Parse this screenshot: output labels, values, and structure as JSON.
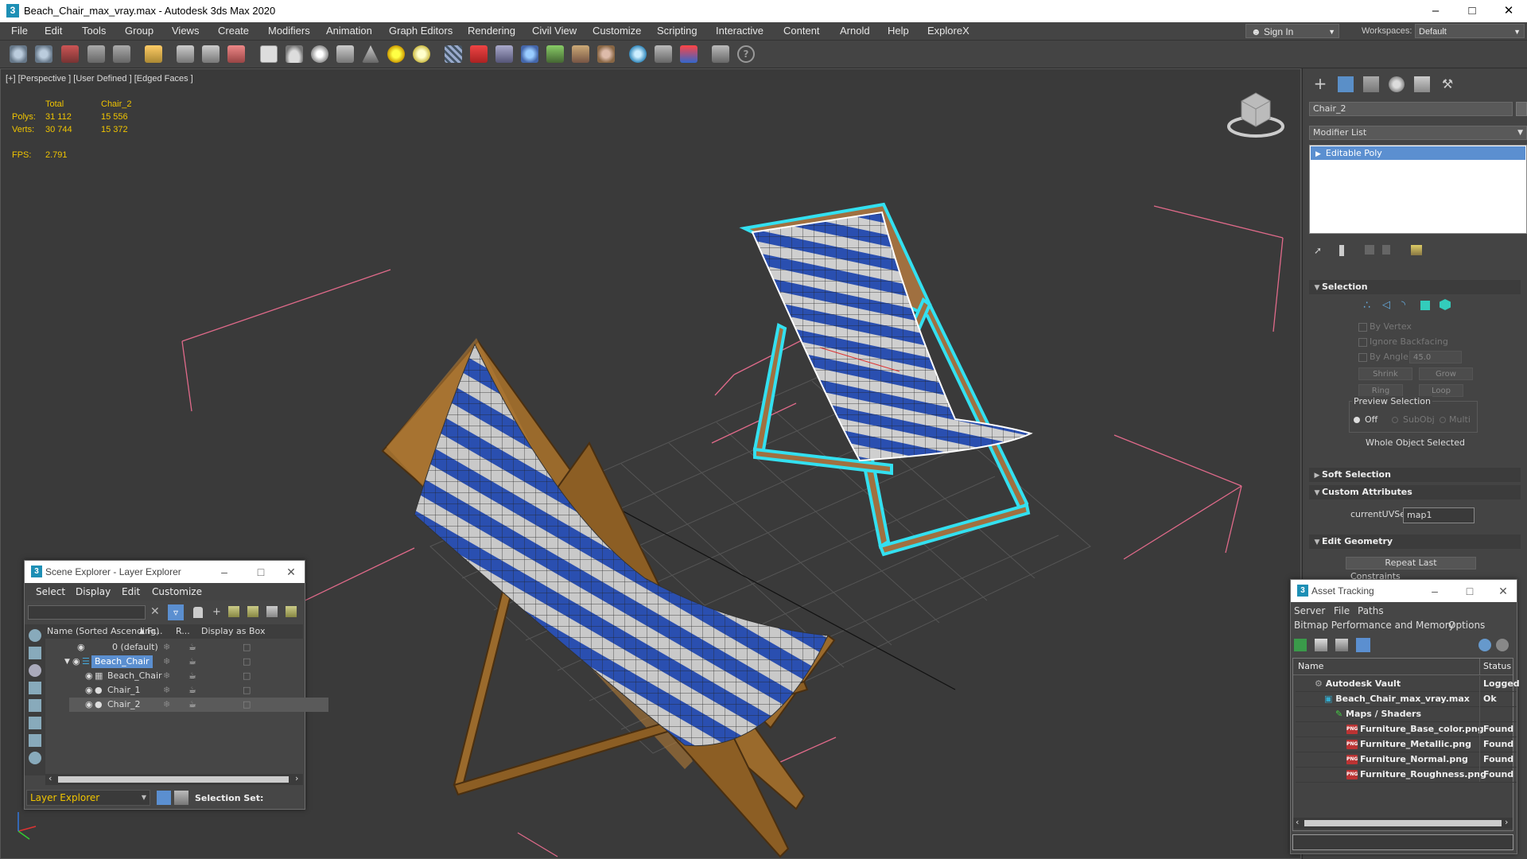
{
  "titlebar": {
    "title": "Beach_Chair_max_vray.max - Autodesk 3ds Max 2020",
    "app_icon": "3"
  },
  "menu": [
    "File",
    "Edit",
    "Tools",
    "Group",
    "Views",
    "Create",
    "Modifiers",
    "Animation",
    "Graph Editors",
    "Rendering",
    "Civil View",
    "Customize",
    "Scripting",
    "Interactive",
    "Content",
    "Arnold",
    "Help",
    "ExploreX"
  ],
  "signin": "Sign In",
  "workspaces": {
    "label": "Workspaces:",
    "value": "Default"
  },
  "viewport": {
    "label": "[+] [Perspective ] [User Defined ] [Edged Faces ]",
    "stats": {
      "h_total": "Total",
      "h_obj": "Chair_2",
      "polys_label": "Polys:",
      "polys_total": "31 112",
      "polys_obj": "15 556",
      "verts_label": "Verts:",
      "verts_total": "30 744",
      "verts_obj": "15 372",
      "fps_label": "FPS:",
      "fps": "2.791"
    }
  },
  "command_panel": {
    "object_name": "Chair_2",
    "modifier_list": "Modifier List",
    "stack_item": "Editable Poly",
    "selection": {
      "title": "Selection",
      "by_vertex": "By Vertex",
      "ignore_backfacing": "Ignore Backfacing",
      "by_angle": "By Angle:",
      "angle_value": "45.0",
      "shrink": "Shrink",
      "grow": "Grow",
      "ring": "Ring",
      "loop": "Loop",
      "preview_title": "Preview Selection",
      "off": "Off",
      "subobj": "SubObj",
      "multi": "Multi",
      "status": "Whole Object Selected"
    },
    "soft_selection": "Soft Selection",
    "custom_attributes": {
      "title": "Custom Attributes",
      "label": "currentUVSet",
      "value": "map1"
    },
    "edit_geometry": {
      "title": "Edit Geometry",
      "repeat_last": "Repeat Last",
      "constraints": "Constraints"
    }
  },
  "scene_explorer": {
    "title": "Scene Explorer - Layer Explorer",
    "menu": [
      "Select",
      "Display",
      "Edit",
      "Customize"
    ],
    "columns": [
      "Name (Sorted Ascending)",
      "Fr...",
      "R...",
      "Display as Box"
    ],
    "rows": [
      {
        "name": "0 (default)"
      },
      {
        "name": "Beach_Chair"
      },
      {
        "name": "Beach_Chair"
      },
      {
        "name": "Chair_1"
      },
      {
        "name": "Chair_2"
      }
    ],
    "footer_dropdown": "Layer Explorer",
    "selection_set": "Selection Set:"
  },
  "asset_tracking": {
    "title": "Asset Tracking",
    "menu": [
      "Server",
      "File",
      "Paths"
    ],
    "menu2": [
      "Bitmap Performance and Memory",
      "Options"
    ],
    "columns": [
      "Name",
      "Status"
    ],
    "rows": [
      {
        "name": "Autodesk Vault",
        "status": "Logged"
      },
      {
        "name": "Beach_Chair_max_vray.max",
        "status": "Ok"
      },
      {
        "name": "Maps / Shaders",
        "status": ""
      },
      {
        "name": "Furniture_Base_color.png",
        "status": "Found"
      },
      {
        "name": "Furniture_Metallic.png",
        "status": "Found"
      },
      {
        "name": "Furniture_Normal.png",
        "status": "Found"
      },
      {
        "name": "Furniture_Roughness.png",
        "status": "Found"
      }
    ]
  },
  "colors": {
    "accent": "#4a7fc4",
    "stat_yellow": "#f0c400",
    "selection_cyan": "#33e0f0",
    "stripe_blue": "#2a4fb0",
    "wood": "#9a6a2c"
  }
}
